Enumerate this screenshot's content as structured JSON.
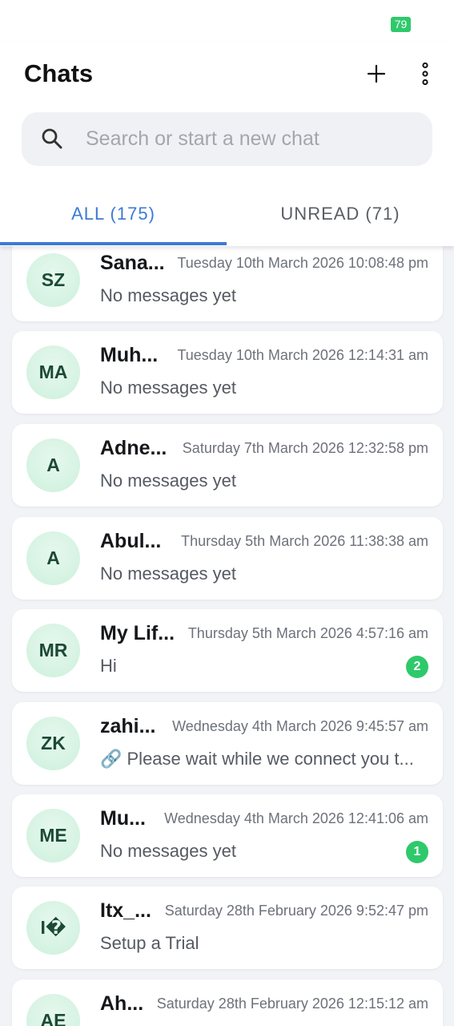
{
  "status_bar": {
    "battery": "79"
  },
  "header": {
    "title": "Chats",
    "new_chat_icon": "plus-icon",
    "menu_icon": "more-vertical-icon"
  },
  "search": {
    "icon": "search-icon",
    "placeholder": "Search or start a new chat",
    "value": ""
  },
  "tabs": [
    {
      "label": "ALL (175)",
      "active": true
    },
    {
      "label": "UNREAD (71)",
      "active": false
    }
  ],
  "colors": {
    "accent": "#3d7ad6",
    "badge": "#2ec96b",
    "avatar_bg": "#cdf0dc",
    "avatar_text": "#1c4a35"
  },
  "chats": [
    {
      "initials": "SZ",
      "name": "Sana...",
      "time": "Tuesday 10th March 2026 10:08:48 pm",
      "preview": "No messages yet",
      "unread": ""
    },
    {
      "initials": "MA",
      "name": "Muh...",
      "time": "Tuesday 10th March 2026 12:14:31 am",
      "preview": "No messages yet",
      "unread": ""
    },
    {
      "initials": "A",
      "name": "Adne...",
      "time": "Saturday 7th March 2026 12:32:58 pm",
      "preview": "No messages yet",
      "unread": ""
    },
    {
      "initials": "A",
      "name": "Abul...",
      "time": "Thursday 5th March 2026 11:38:38 am",
      "preview": "No messages yet",
      "unread": ""
    },
    {
      "initials": "MR",
      "name": "My Lif...",
      "time": "Thursday 5th March 2026 4:57:16 am",
      "preview": "Hi",
      "unread": "2"
    },
    {
      "initials": "ZK",
      "name": "zahi...",
      "time": "Wednesday 4th March 2026 9:45:57 am",
      "preview": "🔗 Please wait while we connect you t...",
      "unread": ""
    },
    {
      "initials": "ME",
      "name": "Mu...",
      "time": "Wednesday 4th March 2026 12:41:06 am",
      "preview": "No messages yet",
      "unread": "1"
    },
    {
      "initials": "I�",
      "name": "Itx_...",
      "time": "Saturday 28th February 2026 9:52:47 pm",
      "preview": "Setup a Trial",
      "unread": ""
    },
    {
      "initials": "AE",
      "name": "Ah...",
      "time": "Saturday 28th February 2026 12:15:12 am",
      "preview": "",
      "unread": ""
    }
  ]
}
